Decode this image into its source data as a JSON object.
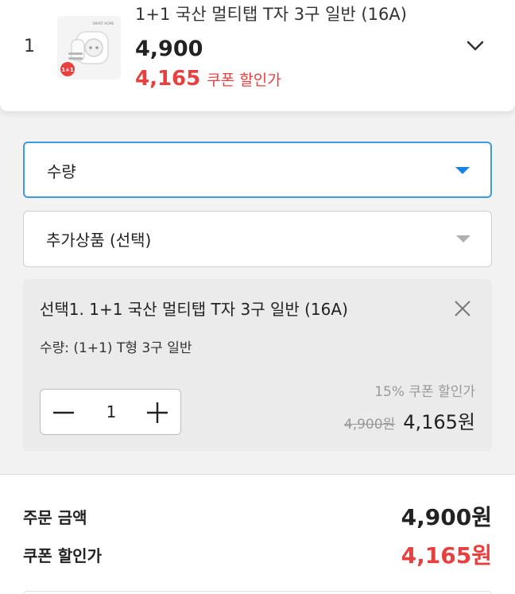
{
  "product": {
    "index": "1",
    "title": "1+1 국산 멀티탭 T자 3구 일반 (16A)",
    "price": "4,900",
    "sale_price": "4,165",
    "sale_label": "쿠폰 할인가",
    "thumb_brand": "SMART HOME",
    "thumb_badge": "1+1"
  },
  "quantity_select": {
    "label": "수량"
  },
  "addon_select": {
    "label": "추가상품 (선택)"
  },
  "selected_option": {
    "title": "선택1. 1+1 국산 멀티탭 T자 3구 일반 (16A)",
    "subtitle": "수량: (1+1) T형 3구 일반",
    "quantity": "1",
    "discount_label": "15% 쿠폰 할인가",
    "original_price": "4,900원",
    "final_price": "4,165원"
  },
  "summary": {
    "order_label": "주문 금액",
    "order_value": "4,900원",
    "coupon_label": "쿠폰 할인가",
    "coupon_value": "4,165원"
  },
  "colors": {
    "accent_red": "#e8403f",
    "focus_blue": "#3b9ae0"
  },
  "icons": [
    "chevron-down-icon",
    "caret-down-icon",
    "close-icon",
    "minus-icon",
    "plus-icon"
  ]
}
